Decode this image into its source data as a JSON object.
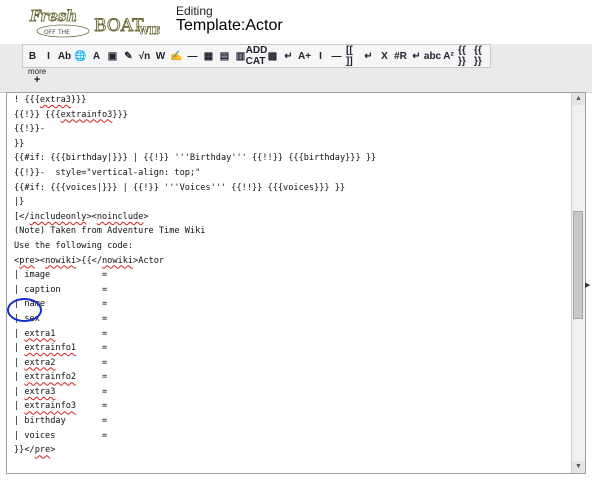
{
  "header": {
    "logo_text": "Fresh Off The Boat Wiki",
    "editing_label": "Editing",
    "page_title": "Template:Actor"
  },
  "toolbar": {
    "buttons": [
      {
        "name": "bold-button",
        "label": "B"
      },
      {
        "name": "italic-button",
        "label": "I"
      },
      {
        "name": "internal-link-button",
        "label": "Ab"
      },
      {
        "name": "external-link-button",
        "label": "🌐"
      },
      {
        "name": "headline-button",
        "label": "A"
      },
      {
        "name": "embedded-file-button",
        "label": "▣"
      },
      {
        "name": "media-button",
        "label": "✎"
      },
      {
        "name": "math-button",
        "label": "√n"
      },
      {
        "name": "nowiki-button",
        "label": "W"
      },
      {
        "name": "signature-button",
        "label": "✍"
      },
      {
        "name": "horizontal-line-button",
        "label": "—"
      },
      {
        "name": "gallery-button",
        "label": "▦"
      },
      {
        "name": "table-button",
        "label": "▤"
      },
      {
        "name": "image-button",
        "label": "▥"
      },
      {
        "name": "add-category-button",
        "label": "ADD CAT"
      },
      {
        "name": "template-button",
        "label": "▩"
      },
      {
        "name": "line-break-button",
        "label": "↵"
      },
      {
        "name": "big-text-button",
        "label": "A+"
      },
      {
        "name": "cursor-button",
        "label": "I"
      },
      {
        "name": "dash-button",
        "label": "—"
      },
      {
        "name": "brackets-button",
        "label": "[[ ]]"
      },
      {
        "name": "return-button",
        "label": "↵"
      },
      {
        "name": "cancel-x-button",
        "label": "X"
      },
      {
        "name": "redirect-button",
        "label": "#R"
      },
      {
        "name": "newline-button",
        "label": "↵"
      },
      {
        "name": "strikethrough-button",
        "label": "abc"
      },
      {
        "name": "superscript-button",
        "label": "A²"
      },
      {
        "name": "template-braces-button",
        "label": "{{ }}"
      },
      {
        "name": "template-braces-2-button",
        "label": "{{ }}"
      }
    ],
    "more_label": "more",
    "more_plus": "+"
  },
  "editor": {
    "lines": [
      [
        {
          "t": "! {{{"
        },
        {
          "t": "extra3",
          "sq": true
        },
        {
          "t": "}}}"
        }
      ],
      [
        {
          "t": "{{!}} {{{"
        },
        {
          "t": "extrainfo3",
          "sq": true
        },
        {
          "t": "}}}"
        }
      ],
      [
        {
          "t": "{{!}}-"
        }
      ],
      [
        {
          "t": "}}"
        }
      ],
      [
        {
          "t": "{{#if: {{{birthday|}}} | {{!}} '''Birthday''' {{!!}} {{{birthday}}} }}"
        }
      ],
      [
        {
          "t": "{{!}}-  style=\"vertical-align: top;\""
        }
      ],
      [
        {
          "t": "{{#if: {{{voices|}}} | {{!}} '''Voices''' {{!!}} {{{voices}}} }}"
        }
      ],
      [
        {
          "t": "|}"
        }
      ],
      [
        {
          "t": "[</"
        },
        {
          "t": "includeonly",
          "sq": true
        },
        {
          "t": "><"
        },
        {
          "t": "noinclude",
          "sq": true
        },
        {
          "t": ">"
        }
      ],
      [
        {
          "t": "(Note) Taken from Adventure Time Wiki"
        }
      ],
      [
        {
          "t": "Use the following code:"
        }
      ],
      [
        {
          "t": "<"
        },
        {
          "t": "pre",
          "sq": true
        },
        {
          "t": "><"
        },
        {
          "t": "nowiki",
          "sq": true
        },
        {
          "t": ">{{</"
        },
        {
          "t": "nowiki",
          "sq": true
        },
        {
          "t": ">Actor"
        }
      ],
      [
        {
          "t": "| image          ="
        }
      ],
      [
        {
          "t": "| caption        ="
        }
      ],
      [
        {
          "t": "| name           ="
        }
      ],
      [
        {
          "t": "| sex            ="
        }
      ],
      [
        {
          "t": "| "
        },
        {
          "t": "extra1",
          "sq": true
        },
        {
          "t": "         ="
        }
      ],
      [
        {
          "t": "| "
        },
        {
          "t": "extrainfo1",
          "sq": true
        },
        {
          "t": "     ="
        }
      ],
      [
        {
          "t": "| "
        },
        {
          "t": "extra2",
          "sq": true
        },
        {
          "t": "         ="
        }
      ],
      [
        {
          "t": "| "
        },
        {
          "t": "extrainfo2",
          "sq": true
        },
        {
          "t": "     ="
        }
      ],
      [
        {
          "t": "| "
        },
        {
          "t": "extra3",
          "sq": true
        },
        {
          "t": "         ="
        }
      ],
      [
        {
          "t": "| "
        },
        {
          "t": "extrainfo3",
          "sq": true
        },
        {
          "t": "     ="
        }
      ],
      [
        {
          "t": "| birthday       ="
        }
      ],
      [
        {
          "t": "| voices         ="
        }
      ],
      [
        {
          "t": "}}</"
        },
        {
          "t": "pre",
          "sq": true
        },
        {
          "t": ">"
        }
      ]
    ]
  },
  "scrollbar": {
    "up_arrow": "▲",
    "down_arrow": "▼"
  },
  "collapse_arrow": "▶"
}
